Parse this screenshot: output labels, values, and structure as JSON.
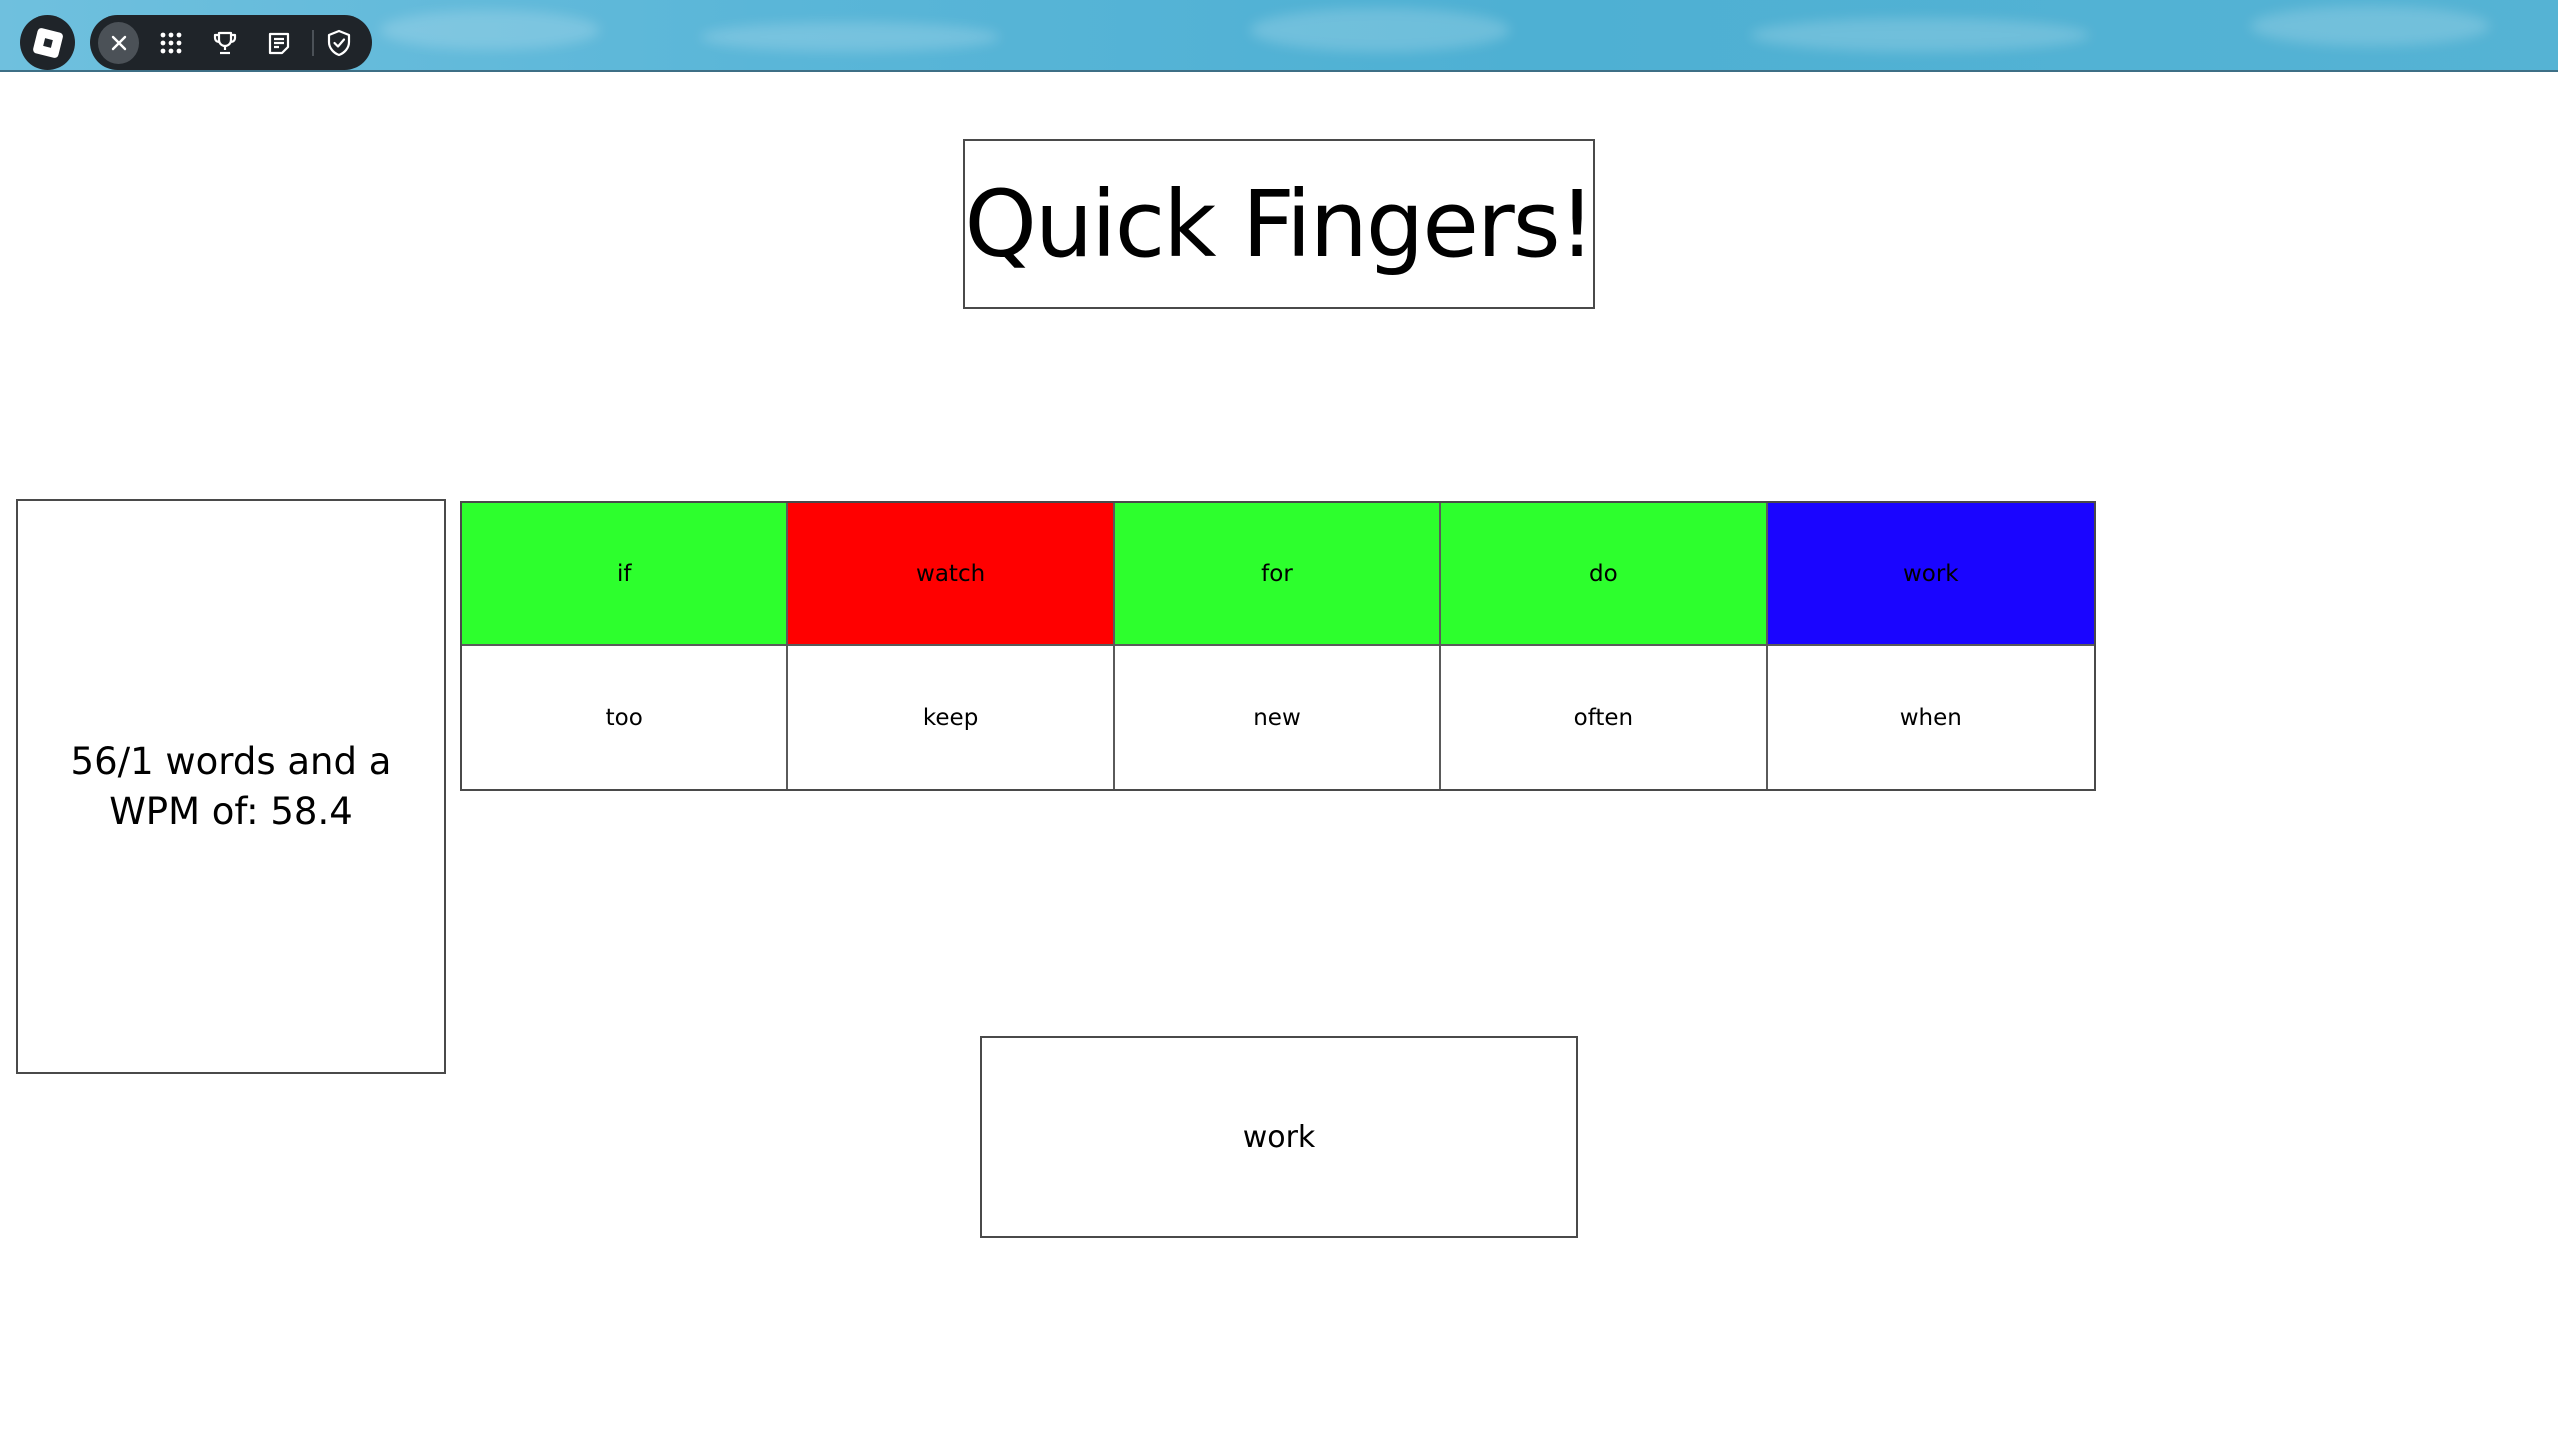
{
  "topbar": {
    "menu_icons": [
      "roblox-logo-icon",
      "close-icon",
      "apps-grid-icon",
      "trophy-icon",
      "chat-icon",
      "shield-icon"
    ]
  },
  "game": {
    "title": "Quick Fingers!",
    "stats": "56/1 words and a WPM of: 58.4",
    "current_word": "work",
    "words_row1": [
      {
        "word": "if",
        "color": "#2dff2d"
      },
      {
        "word": "watch",
        "color": "#ff0000"
      },
      {
        "word": "for",
        "color": "#2dff2d"
      },
      {
        "word": "do",
        "color": "#2dff2d"
      },
      {
        "word": "work",
        "color": "#1a05ff"
      }
    ],
    "words_row2": [
      {
        "word": "too",
        "color": "#ffffff"
      },
      {
        "word": "keep",
        "color": "#ffffff"
      },
      {
        "word": "new",
        "color": "#ffffff"
      },
      {
        "word": "often",
        "color": "#ffffff"
      },
      {
        "word": "when",
        "color": "#ffffff"
      }
    ]
  }
}
